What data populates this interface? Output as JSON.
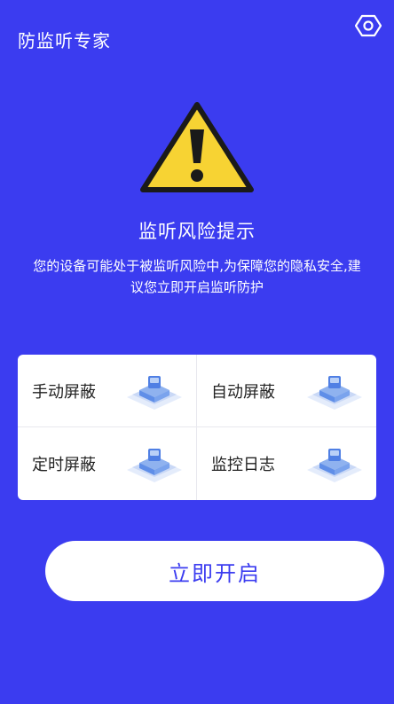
{
  "header": {
    "title": "防监听专家",
    "settings_icon": "settings-icon"
  },
  "alert": {
    "icon": "warning-icon",
    "title": "监听风险提示",
    "description": "您的设备可能处于被监听风险中,为保障您的隐私安全,建议您立即开启监听防护"
  },
  "features": [
    {
      "label": "手动屏蔽",
      "icon": "shield-device-icon"
    },
    {
      "label": "自动屏蔽",
      "icon": "shield-device-icon"
    },
    {
      "label": "定时屏蔽",
      "icon": "shield-device-icon"
    },
    {
      "label": "监控日志",
      "icon": "shield-device-icon"
    }
  ],
  "action": {
    "start_label": "立即开启"
  },
  "colors": {
    "background": "#3b3cf0",
    "warning_fill": "#f7d333",
    "warning_stroke": "#1a1a1a",
    "button_text": "#3b3cf0"
  }
}
